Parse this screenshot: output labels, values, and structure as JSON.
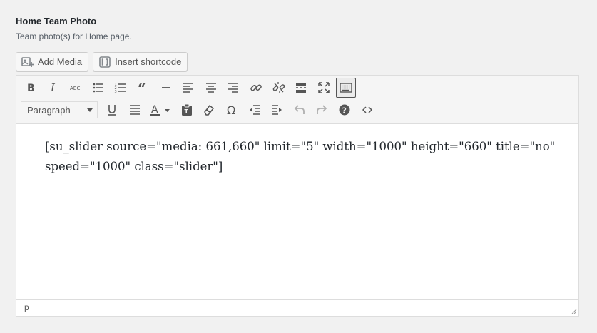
{
  "field": {
    "title": "Home Team Photo",
    "description": "Team photo(s) for Home page."
  },
  "media_buttons": {
    "add_media": "Add Media",
    "insert_shortcode": "Insert shortcode"
  },
  "toolbar": {
    "row1_icons": [
      "bold-icon",
      "italic-icon",
      "strikethrough-icon",
      "bullet-list-icon",
      "numbered-list-icon",
      "blockquote-icon",
      "horizontal-line-icon",
      "align-left-icon",
      "align-center-icon",
      "align-right-icon",
      "link-icon",
      "unlink-icon",
      "read-more-icon",
      "fullscreen-icon",
      "toolbar-toggle-icon"
    ],
    "format_select_value": "Paragraph",
    "row2_icons": [
      "underline-icon",
      "justify-icon",
      "text-color-icon",
      "paste-as-text-icon",
      "clear-formatting-icon",
      "special-character-icon",
      "outdent-icon",
      "indent-icon",
      "undo-icon",
      "redo-icon",
      "help-icon",
      "code-icon"
    ],
    "active_icon": "toolbar-toggle-icon"
  },
  "editor": {
    "content": "[su_slider source=\"media: 661,660\" limit=\"5\" width=\"1000\" height=\"660\" title=\"no\" speed=\"1000\" class=\"slider\"]"
  },
  "statusbar": {
    "path": "p"
  },
  "colors": {
    "background": "#f1f1f1",
    "icon": "#555555",
    "border": "#dddddd"
  }
}
